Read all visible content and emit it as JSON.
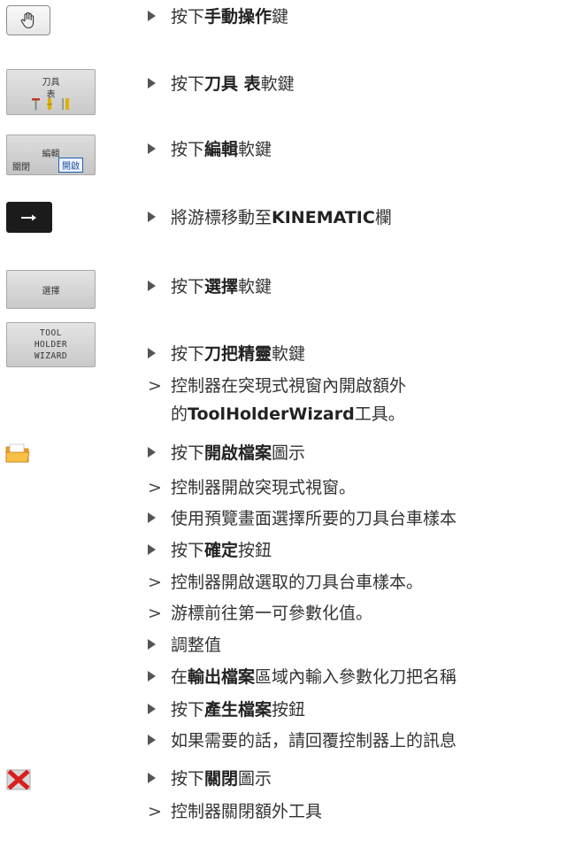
{
  "icons": {
    "manual_key": "hand-icon",
    "tool_table_label_1": "刀具",
    "tool_table_label_2": "表",
    "edit_label": "編輯",
    "edit_off": "關閉",
    "edit_on": "開啟",
    "select_label": "選擇",
    "wizard_l1": "TOOL",
    "wizard_l2": "HOLDER",
    "wizard_l3": "WIZARD",
    "open_file_icon": "folder-icon",
    "close_icon": "close-icon"
  },
  "steps": [
    {
      "type": "action",
      "pre": "按下",
      "bold": "手動操作",
      "post": "鍵"
    },
    {
      "type": "action",
      "pre": "按下",
      "bold": "刀具 表",
      "post": "軟鍵"
    },
    {
      "type": "action",
      "pre": "按下",
      "bold": "編輯",
      "post": "軟鍵"
    },
    {
      "type": "action",
      "pre": "將游標移動至",
      "bold": "KINEMATIC",
      "post": "欄"
    },
    {
      "type": "action",
      "pre": "按下",
      "bold": "選擇",
      "post": "軟鍵"
    },
    {
      "type": "action",
      "pre": "按下",
      "bold": "刀把精靈",
      "post": "軟鍵"
    },
    {
      "type": "result",
      "pre": "控制器在突現式視窗內開啟額外",
      "bold": "",
      "post": ""
    },
    {
      "type": "none",
      "pre": "的",
      "bold": "ToolHolderWizard",
      "post": "工具。"
    },
    {
      "type": "action",
      "pre": "按下",
      "bold": "開啟檔案",
      "post": "圖示"
    },
    {
      "type": "result",
      "pre": "控制器開啟突現式視窗。",
      "bold": "",
      "post": ""
    },
    {
      "type": "action",
      "pre": "使用預覽畫面選擇所要的刀具台車樣本",
      "bold": "",
      "post": ""
    },
    {
      "type": "action",
      "pre": "按下",
      "bold": "確定",
      "post": "按鈕"
    },
    {
      "type": "result",
      "pre": "控制器開啟選取的刀具台車樣本。",
      "bold": "",
      "post": ""
    },
    {
      "type": "result",
      "pre": "游標前往第一可參數化值。",
      "bold": "",
      "post": ""
    },
    {
      "type": "action",
      "pre": "調整值",
      "bold": "",
      "post": ""
    },
    {
      "type": "action",
      "pre": "在",
      "bold": "輸出檔案",
      "post": "區域內輸入參數化刀把名稱"
    },
    {
      "type": "action",
      "pre": "按下",
      "bold": "產生檔案",
      "post": "按鈕"
    },
    {
      "type": "action",
      "pre": "如果需要的話，請回覆控制器上的訊息",
      "bold": "",
      "post": ""
    },
    {
      "type": "action",
      "pre": "按下",
      "bold": "關閉",
      "post": "圖示"
    },
    {
      "type": "result",
      "pre": "控制器關閉額外工具",
      "bold": "",
      "post": ""
    }
  ]
}
